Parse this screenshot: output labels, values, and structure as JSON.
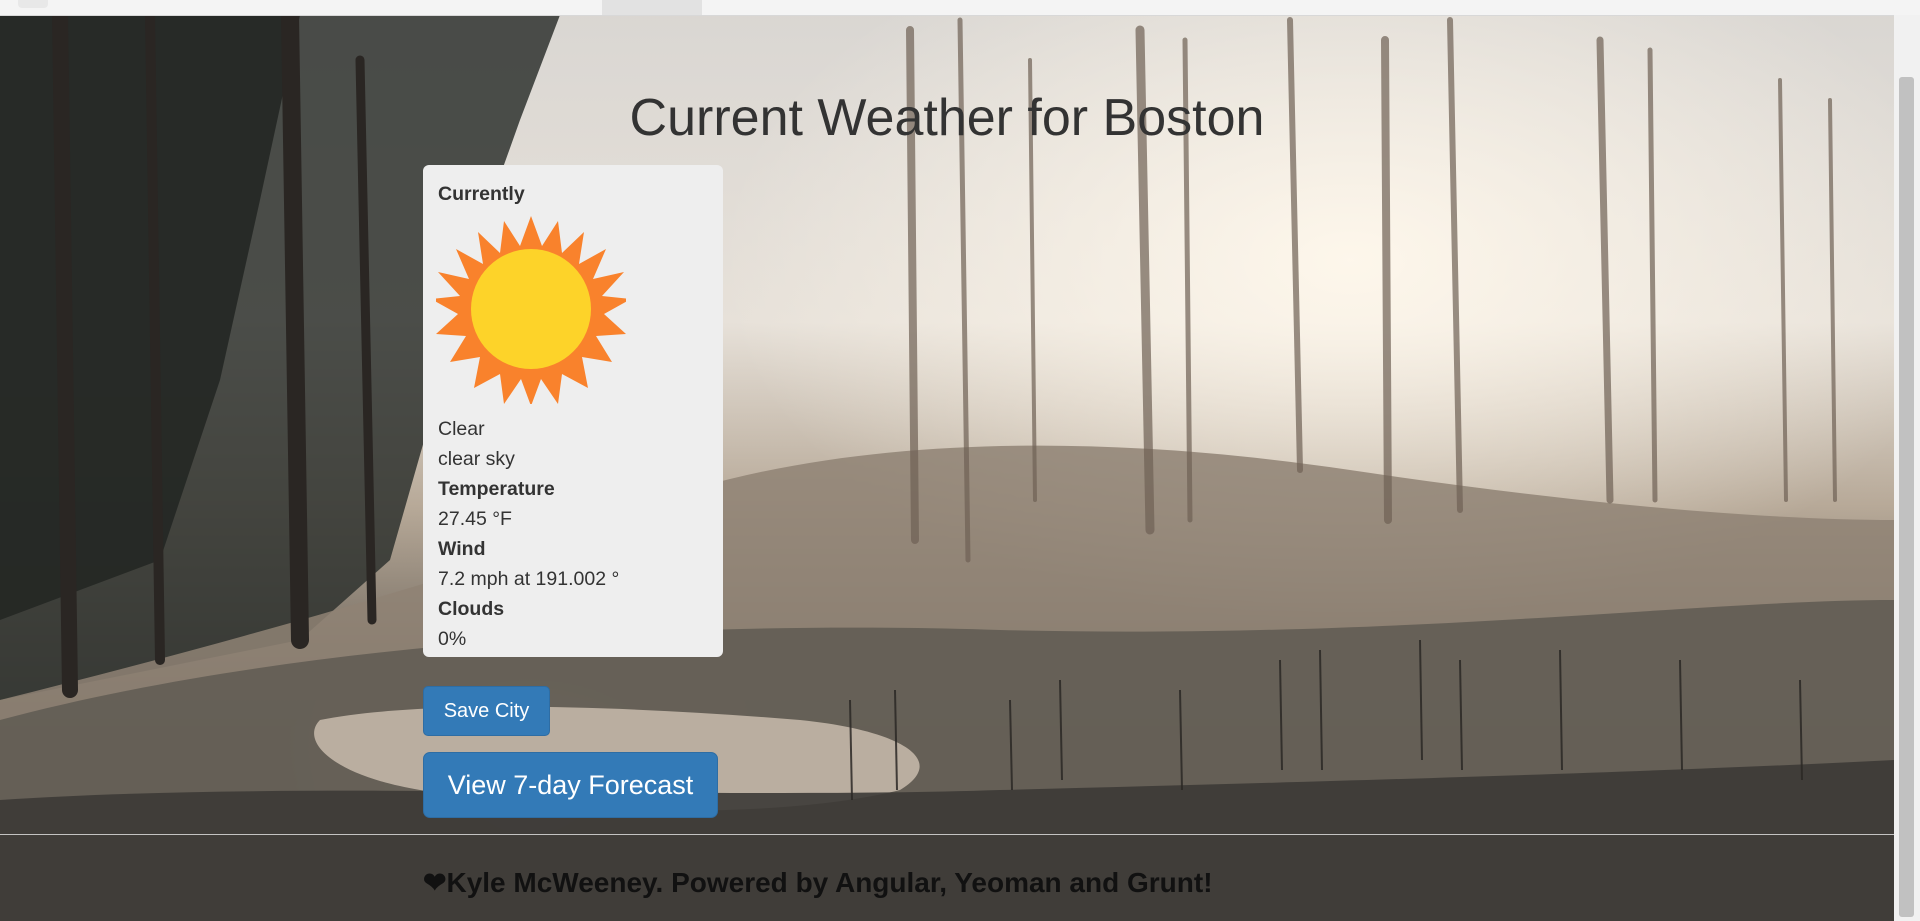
{
  "page": {
    "title": "Current Weather for Boston"
  },
  "weather": {
    "heading": "Currently",
    "icon": "sun-icon",
    "condition": "Clear",
    "description": "clear sky",
    "temperature_label": "Temperature",
    "temperature_value": "27.45 °F",
    "wind_label": "Wind",
    "wind_value": "7.2 mph at 191.002 °",
    "clouds_label": "Clouds",
    "clouds_value": "0%"
  },
  "actions": {
    "save_label": "Save City",
    "forecast_label": "View 7-day Forecast"
  },
  "footer": {
    "heart": "❤",
    "text": "Kyle McWeeney. Powered by Angular, Yeoman and Grunt!"
  },
  "colors": {
    "primary_button": "#337ab7",
    "panel_bg": "#eeeeee",
    "sun_core": "#fdd329",
    "sun_rays": "#f9822c"
  }
}
